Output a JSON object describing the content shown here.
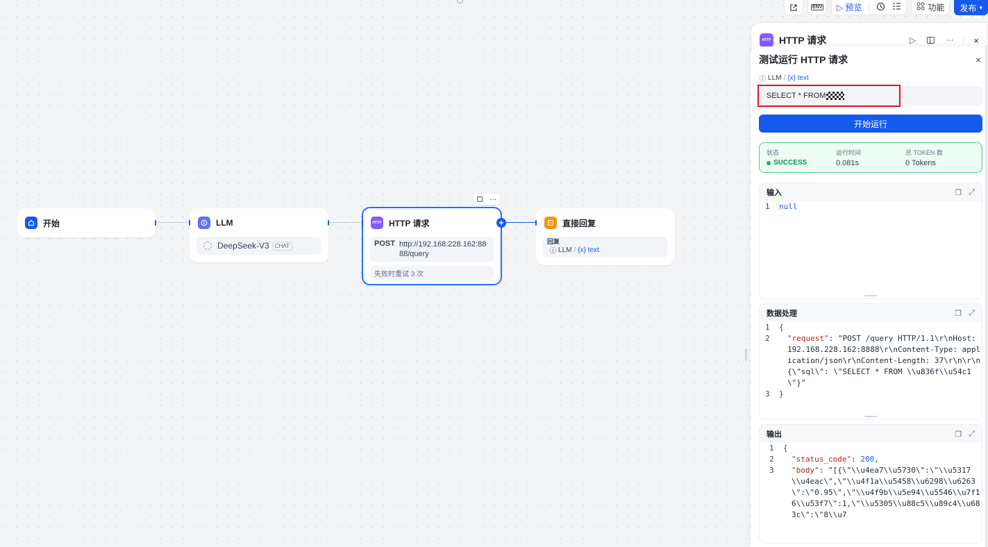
{
  "colors": {
    "accent": "#155aef",
    "success": "#079455",
    "start_icon": "#155aef",
    "llm_icon": "#6172f3",
    "http_icon": "#875bf7",
    "answer_icon": "#f79009"
  },
  "toolbar": {
    "preview_label": "预览",
    "features_label": "功能",
    "publish_label": "发布",
    "env_label": "ENV"
  },
  "nodes": {
    "start": {
      "title": "开始"
    },
    "llm": {
      "title": "LLM",
      "model": "DeepSeek-V3",
      "model_badge": "CHAT"
    },
    "http": {
      "title": "HTTP 请求",
      "method": "POST",
      "url": "http://192.168.228.162:8888/query",
      "retry": "失败时重试 3 次"
    },
    "answer": {
      "title": "直接回复",
      "reply_label": "回复",
      "var_node": "LLM",
      "var_sep": "/",
      "var_name": "{x} text"
    }
  },
  "panel": {
    "header_title": "HTTP 请求",
    "title": "测试运行 HTTP 请求",
    "var_node": "LLM",
    "var_sep": "/",
    "var_name": "{x} text",
    "input_value": "SELECT * FROM",
    "run_button": "开始运行",
    "status": {
      "status_label": "状态",
      "status_value": "SUCCESS",
      "time_label": "运行时间",
      "time_value": "0.081s",
      "token_label": "总 TOKEN 数",
      "token_value": "0 Tokens"
    },
    "input_section": {
      "title": "输入",
      "lines": [
        {
          "no": "1",
          "text": "null"
        }
      ]
    },
    "process_section": {
      "title": "数据处理",
      "line1_no": "1",
      "line1": "{",
      "line2_no": "2",
      "line2_key": "\"request\"",
      "line2_val": ": \"POST /query HTTP/1.1\\r\\nHost: 192.168.228.162:8888\\r\\nContent-Type: application/json\\r\\nContent-Length: 37\\r\\n\\r\\n{\\\"sql\\\": \\\"SELECT * FROM \\\\u836f\\\\u54c1\\\"}\"",
      "line3_no": "3",
      "line3": "}"
    },
    "output_section": {
      "title": "输出",
      "line1_no": "1",
      "line1": "{",
      "line2_no": "2",
      "line2_key": "\"status_code\"",
      "line2_colon": ": ",
      "line2_val": "200",
      "line2_end": ",",
      "line3_no": "3",
      "line3_key": "\"body\"",
      "line3_val": ": \"[{\\\"\\\\u4ea7\\\\u5730\\\":\\\"\\\\u5317\\\\u4eac\\\",\\\"\\\\u4f1a\\\\u5458\\\\u6298\\\\u6263\\\":\\\"0.95\\\",\\\"\\\\u4f9b\\\\u5e94\\\\u5546\\\\u7f16\\\\u53f7\\\":1,\\\"\\\\u5305\\\\u88c5\\\\u89c4\\\\u683c\\\":\\\"8\\\\u7"
    }
  }
}
